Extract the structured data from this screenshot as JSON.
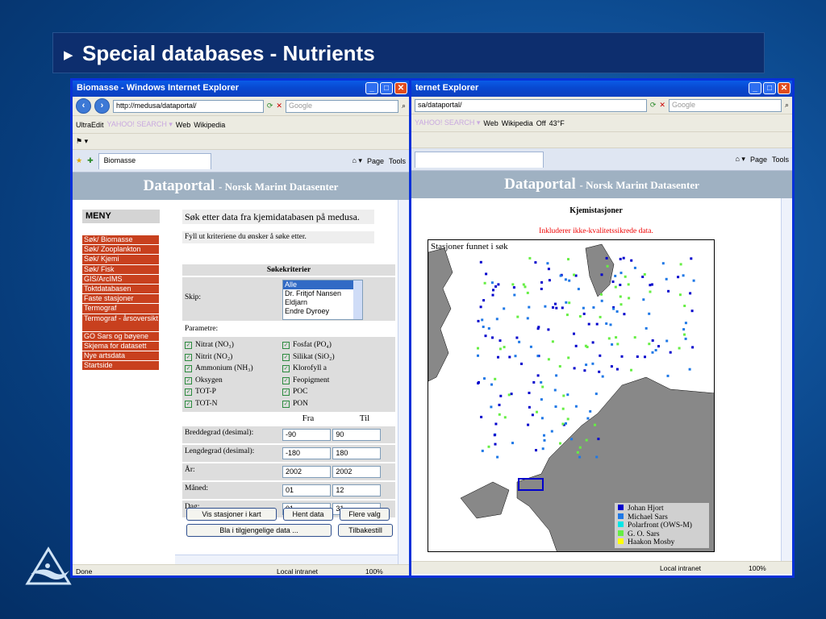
{
  "slide": {
    "title": "Special databases - Nutrients"
  },
  "left": {
    "window_title": "Biomasse - Windows Internet Explorer",
    "address": "http://medusa/dataportal/",
    "search_placeholder": "Google",
    "toolbar": [
      "UltraEdit",
      "Web",
      "Wikipedia"
    ],
    "tab": "Biomasse",
    "cmd": [
      "Page",
      "Tools"
    ],
    "header_title": "Dataportal",
    "header_sub": "- Norsk Marint Datasenter",
    "menu_title": "MENY",
    "menu_items": [
      "Søk/ Biomasse",
      "Søk/ Zooplankton",
      "Søk/ Kjemi",
      "Søk/ Fisk",
      "GIS/ArcIMS",
      "Toktdatabasen",
      "Faste stasjoner",
      "Termograf",
      "Termograf - årsoversikt",
      "GO Sars og bøyene",
      "Skjema for datasett",
      "Nye artsdata",
      "Startside"
    ],
    "intro": "Søk etter data fra kjemidatabasen på medusa.",
    "instructions": "Fyll ut kriteriene du ønsker å søke etter.",
    "form": {
      "heading": "Søkekriterier",
      "ship_label": "Skip:",
      "ships": [
        "Alle",
        "Dr. Fritjof Nansen",
        "Eldjarn",
        "Endre Dyroey"
      ],
      "param_label": "Parametre:",
      "params_left": [
        "Nitrat (NO₃)",
        "Nitrit (NO₂)",
        "Ammonium (NH₃)",
        "Oksygen",
        "TOT-P",
        "TOT-N"
      ],
      "params_right": [
        "Fosfat (PO₄)",
        "Silikat (SiO₂)",
        "Klorofyll a",
        "Feopigment",
        "POC",
        "PON"
      ],
      "from_label": "Fra",
      "to_label": "Til",
      "ranges": [
        {
          "label": "Breddegrad (desimal):",
          "from": "-90",
          "to": "90"
        },
        {
          "label": "Lengdegrad (desimal):",
          "from": "-180",
          "to": "180"
        },
        {
          "label": "År:",
          "from": "2002",
          "to": "2002"
        },
        {
          "label": "Måned:",
          "from": "01",
          "to": "12"
        },
        {
          "label": "Dag:",
          "from": "01",
          "to": "31"
        }
      ],
      "btn_map": "Vis stasjoner i kart",
      "btn_fetch": "Hent data",
      "btn_more": "Flere valg",
      "btn_browse": "Bla i tilgjengelige data ...",
      "btn_reset": "Tilbakestill"
    },
    "status_left": "Done",
    "status_zone": "Local intranet",
    "status_zoom": "100%"
  },
  "right": {
    "window_title": "ternet Explorer",
    "address": "sa/dataportal/",
    "search_placeholder": "Google",
    "weather": "43°F",
    "off_label": "Off",
    "map_heading": "Kjemistasjoner",
    "map_note": "Inkluderer ikke-kvalitetssikrede data.",
    "map_caption": "Stasjoner funnet i søk",
    "legend": [
      {
        "name": "Johan Hjort",
        "color": "#0000cc"
      },
      {
        "name": "Michael Sars",
        "color": "#1e78e6"
      },
      {
        "name": "Polarfront (OWS-M)",
        "color": "#00e6e6"
      },
      {
        "name": "G. O. Sars",
        "color": "#66ee44"
      },
      {
        "name": "Haakon Mosby",
        "color": "#ffff00"
      }
    ],
    "status_zone": "Local intranet",
    "status_zoom": "100%"
  }
}
